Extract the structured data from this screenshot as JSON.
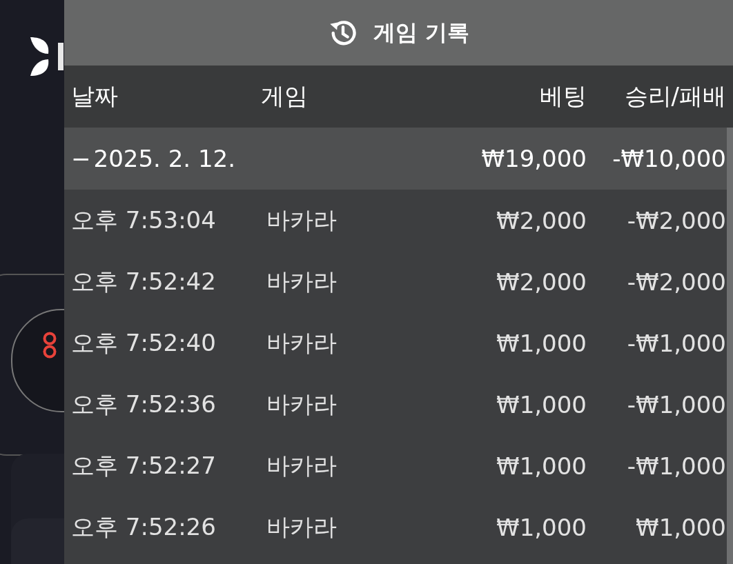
{
  "panel": {
    "title": "게임 기록"
  },
  "table": {
    "columns": [
      "날짜",
      "게임",
      "베팅",
      "승리/패배"
    ],
    "groups": [
      {
        "toggle": "−",
        "expanded": true,
        "date": "2025. 2. 12.",
        "bet": "₩19,000",
        "result": "-₩10,000",
        "rows": [
          {
            "time": "오후 7:53:04",
            "game": "바카라",
            "bet": "₩2,000",
            "result": "-₩2,000"
          },
          {
            "time": "오후 7:52:42",
            "game": "바카라",
            "bet": "₩2,000",
            "result": "-₩2,000"
          },
          {
            "time": "오후 7:52:40",
            "game": "바카라",
            "bet": "₩1,000",
            "result": "-₩1,000"
          },
          {
            "time": "오후 7:52:36",
            "game": "바카라",
            "bet": "₩1,000",
            "result": "-₩1,000"
          },
          {
            "time": "오후 7:52:27",
            "game": "바카라",
            "bet": "₩1,000",
            "result": "-₩1,000"
          },
          {
            "time": "오후 7:52:26",
            "game": "바카라",
            "bet": "₩1,000",
            "result": "₩1,000"
          }
        ]
      }
    ]
  }
}
